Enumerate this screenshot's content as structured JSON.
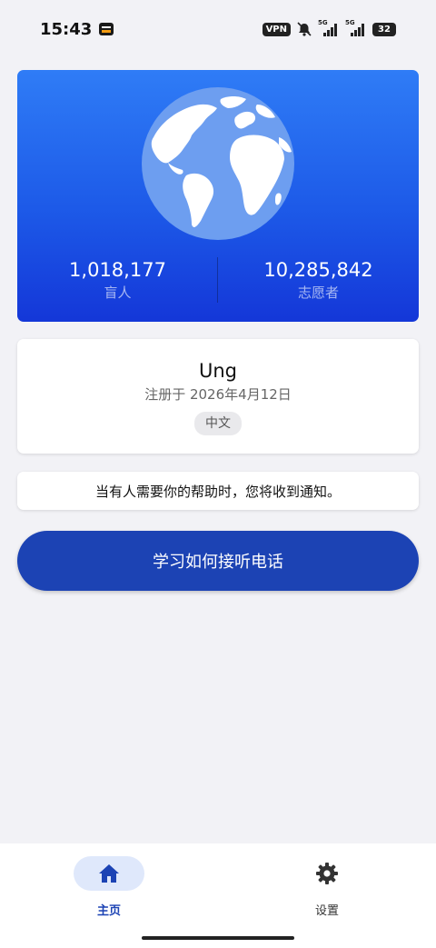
{
  "status_bar": {
    "time": "15:43",
    "vpn": "VPN",
    "net1": "5G",
    "net2": "5G",
    "battery": "32"
  },
  "hero": {
    "blind_count": "1,018,177",
    "blind_label": "盲人",
    "volunteer_count": "10,285,842",
    "volunteer_label": "志愿者"
  },
  "profile": {
    "name": "Ung",
    "registered": "注册于 2026年4月12日",
    "language": "中文"
  },
  "notice": "当有人需要你的帮助时，您将收到通知。",
  "cta_label": "学习如何接听电话",
  "nav": {
    "home_label": "主页",
    "settings_label": "设置"
  },
  "colors": {
    "brand_blue": "#1c43b4",
    "hero_top": "#2f7cf6",
    "hero_bottom": "#1437d8"
  }
}
